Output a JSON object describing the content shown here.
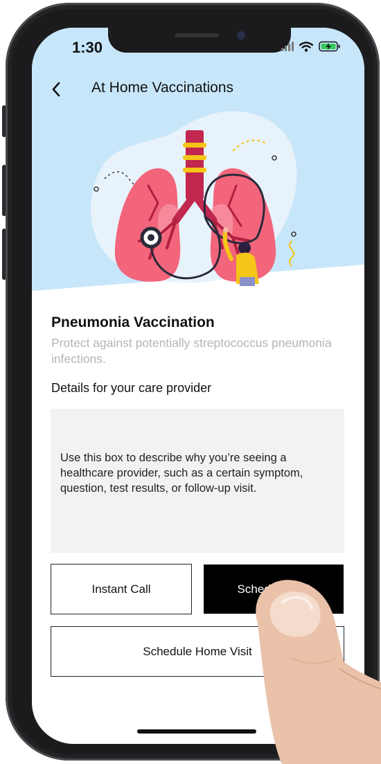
{
  "status_bar": {
    "time": "1:30",
    "icons": [
      "signal-icon",
      "wifi-icon",
      "battery-charging-icon"
    ]
  },
  "header": {
    "back_icon": "chevron-left-icon",
    "title": "At Home Vaccinations"
  },
  "illustration": {
    "icon": "lungs-stethoscope-illustration"
  },
  "content": {
    "title": "Pneumonia Vaccination",
    "subtitle": "Protect against potentially streptococcus pneumonia infections.",
    "details_label": "Details for your care provider",
    "details_placeholder": "Use this box to describe why you’re seeing a healthcare provider, such as a certain symptom, question, test results, or follow-up visit."
  },
  "buttons": {
    "instant_call": "Instant Call",
    "schedule_call": "Schedule Call",
    "schedule_home_visit": "Schedule Home Visit"
  },
  "colors": {
    "header_background": "#c7e6fa",
    "primary_button": "#000000",
    "subtitle_text": "#b5b5b5",
    "details_box": "#f2f2f2",
    "lung": "#f2657a",
    "trachea": "#c1274f",
    "stethoscope": "#2a2a3a",
    "accent_yellow": "#f5c518"
  }
}
